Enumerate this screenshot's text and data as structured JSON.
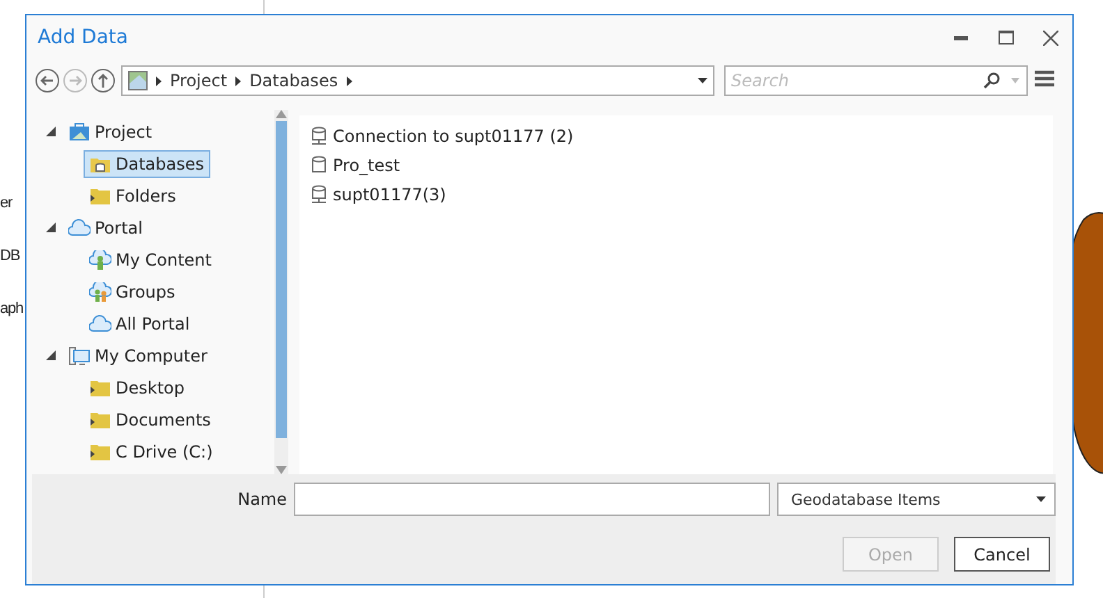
{
  "background_app": {
    "texts": [
      "er",
      "DB",
      "aph"
    ]
  },
  "dialog": {
    "title": "Add Data",
    "breadcrumb": [
      "Project",
      "Databases"
    ],
    "search": {
      "placeholder": "Search"
    },
    "tree": [
      {
        "label": "Project",
        "kind": "project",
        "expanded": true,
        "children": [
          {
            "label": "Databases",
            "kind": "databases",
            "selected": true
          },
          {
            "label": "Folders",
            "kind": "folder",
            "selected": false
          }
        ]
      },
      {
        "label": "Portal",
        "kind": "portal",
        "expanded": true,
        "children": [
          {
            "label": "My Content",
            "kind": "content",
            "selected": false
          },
          {
            "label": "Groups",
            "kind": "groups",
            "selected": false
          },
          {
            "label": "All Portal",
            "kind": "cloud",
            "selected": false
          }
        ]
      },
      {
        "label": "My Computer",
        "kind": "computer",
        "expanded": true,
        "children": [
          {
            "label": "Desktop",
            "kind": "folder",
            "selected": false
          },
          {
            "label": "Documents",
            "kind": "folder",
            "selected": false
          },
          {
            "label": "C Drive (C:)",
            "kind": "folder",
            "selected": false
          }
        ]
      }
    ],
    "items": [
      {
        "label": "Connection to supt01177 (2)",
        "kind": "connection"
      },
      {
        "label": "Pro_test",
        "kind": "database"
      },
      {
        "label": "supt01177(3)",
        "kind": "connection"
      }
    ],
    "name_label": "Name",
    "filter": "Geodatabase Items",
    "buttons": [
      {
        "label": "Open",
        "disabled": true
      },
      {
        "label": "Cancel",
        "disabled": false
      }
    ]
  }
}
